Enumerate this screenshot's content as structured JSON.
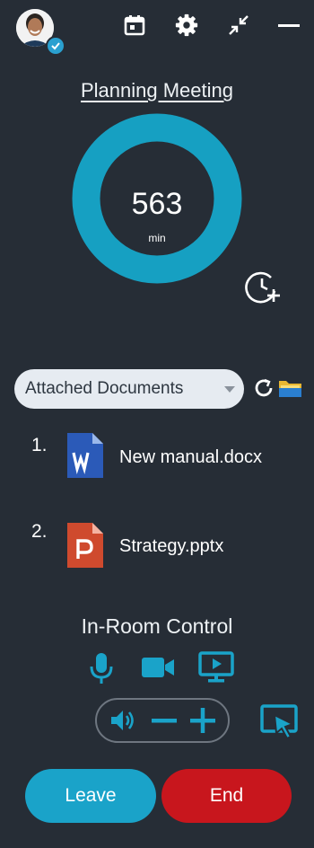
{
  "header": {
    "icons": [
      "avatar",
      "verified-badge-icon",
      "calendar-icon",
      "gear-icon",
      "collapse-icon",
      "minimize-icon"
    ]
  },
  "meeting": {
    "title": "Planning Meeting",
    "remaining_value": "563",
    "remaining_unit": "min",
    "progress_fraction": 1.0
  },
  "documents": {
    "selector_value": "Attached Documents",
    "items": [
      {
        "number": "1.",
        "name": "New manual.docx",
        "icon": "word-doc-icon"
      },
      {
        "number": "2.",
        "name": "Strategy.pptx",
        "icon": "powerpoint-icon"
      }
    ]
  },
  "room_control": {
    "title": "In-Room Control",
    "icons": [
      "microphone-icon",
      "camera-icon",
      "present-icon",
      "volume-icon",
      "minus-icon",
      "plus-icon",
      "screen-share-icon"
    ]
  },
  "actions": {
    "leave_label": "Leave",
    "end_label": "End"
  },
  "colors": {
    "background": "#262d36",
    "accent": "#1aa3c9",
    "end": "#c8161d",
    "select_bg": "#e6ebf1"
  }
}
